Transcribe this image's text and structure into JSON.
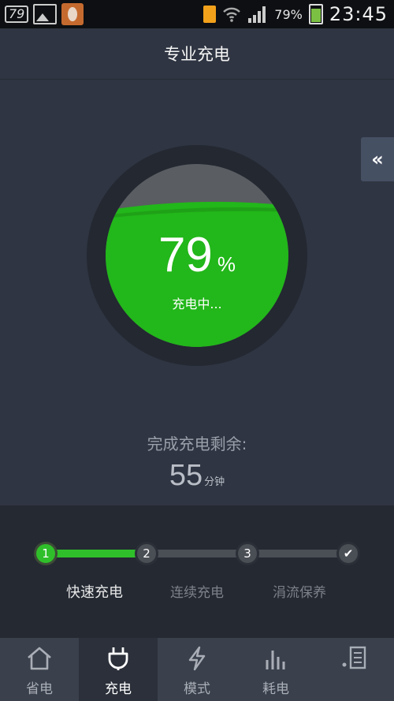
{
  "status_bar": {
    "badge": "79",
    "battery_percent": "79%",
    "time": "23:45"
  },
  "header": {
    "title": "专业充电"
  },
  "side_button": {
    "label": "«"
  },
  "charge": {
    "level": 79,
    "percent_value": "79",
    "percent_unit": "%",
    "status": "充电中..."
  },
  "remaining": {
    "label": "完成充电剩余:",
    "value": "55",
    "unit": "分钟"
  },
  "steps": {
    "progress": 0.33,
    "items": [
      {
        "label": "1",
        "name": "快速充电",
        "active": true
      },
      {
        "label": "2",
        "name": "连续充电",
        "active": false
      },
      {
        "label": "3",
        "name": "涓流保养",
        "active": false
      },
      {
        "label": "✔",
        "name": "",
        "active": false
      }
    ]
  },
  "nav": {
    "items": [
      {
        "label": "省电",
        "icon": "home-icon"
      },
      {
        "label": "充电",
        "icon": "plug-icon"
      },
      {
        "label": "模式",
        "icon": "lightning-icon"
      },
      {
        "label": "耗电",
        "icon": "bar-chart-icon"
      },
      {
        "label": "",
        "icon": "list-icon"
      }
    ],
    "active_index": 1
  },
  "colors": {
    "accent_green": "#2fbf2a",
    "background": "#2f3542"
  }
}
